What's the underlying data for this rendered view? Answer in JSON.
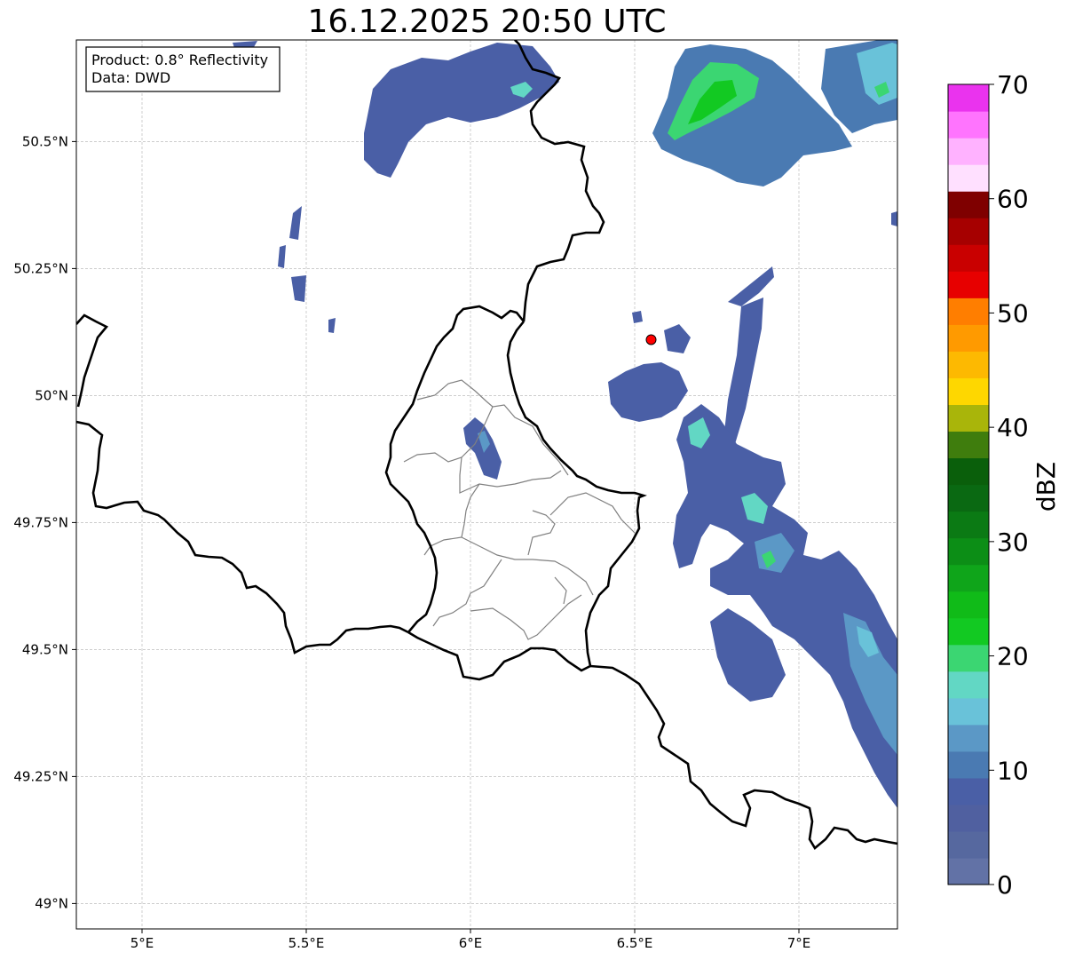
{
  "title": "16.12.2025 20:50 UTC",
  "info_box": {
    "line1": "Product: 0.8° Reflectivity",
    "line2": "Data: DWD"
  },
  "map": {
    "lon_range": [
      4.8,
      7.3
    ],
    "lat_range": [
      48.95,
      50.7
    ],
    "x_ticks": [
      {
        "value": 5.0,
        "label": "5°E"
      },
      {
        "value": 5.5,
        "label": "5.5°E"
      },
      {
        "value": 6.0,
        "label": "6°E"
      },
      {
        "value": 6.5,
        "label": "6.5°E"
      },
      {
        "value": 7.0,
        "label": "7°E"
      }
    ],
    "y_ticks": [
      {
        "value": 50.5,
        "label": "50.5°N"
      },
      {
        "value": 50.25,
        "label": "50.25°N"
      },
      {
        "value": 50.0,
        "label": "50°N"
      },
      {
        "value": 49.75,
        "label": "49.75°N"
      },
      {
        "value": 49.5,
        "label": "49.5°N"
      },
      {
        "value": 49.25,
        "label": "49.25°N"
      },
      {
        "value": 49.0,
        "label": "49°N"
      }
    ],
    "grid": true,
    "marker": {
      "lon": 6.55,
      "lat": 50.11,
      "color": "#ff0000"
    }
  },
  "colorbar": {
    "label": "dBZ",
    "min": 0,
    "max": 70,
    "ticks": [
      {
        "value": 0,
        "label": "0"
      },
      {
        "value": 10,
        "label": "10"
      },
      {
        "value": 20,
        "label": "20"
      },
      {
        "value": 30,
        "label": "30"
      },
      {
        "value": 40,
        "label": "40"
      },
      {
        "value": 50,
        "label": "50"
      },
      {
        "value": 60,
        "label": "60"
      },
      {
        "value": 70,
        "label": "70"
      }
    ],
    "colors": [
      "#6272a6",
      "#56689f",
      "#5060a0",
      "#4a5fa6",
      "#4a7ab2",
      "#5b98c6",
      "#69c2d9",
      "#62d7c4",
      "#3bd672",
      "#12c922",
      "#10bb18",
      "#0fa51a",
      "#0c8e16",
      "#0b7a14",
      "#0a6912",
      "#0a5f0b",
      "#3f7d0d",
      "#a9b50a",
      "#fed700",
      "#fdb901",
      "#ff9a00",
      "#ff7e00",
      "#e70000",
      "#c90000",
      "#a60000",
      "#7f0000",
      "#ffe0ff",
      "#ffb2ff",
      "#ff74fe",
      "#ea33ee"
    ]
  }
}
